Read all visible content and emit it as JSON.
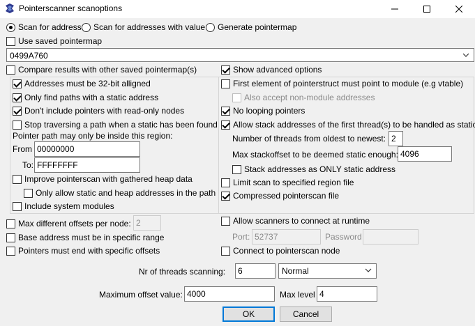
{
  "window": {
    "title": "Pointerscanner scanoptions"
  },
  "scan_mode": {
    "scan_for_address": "Scan for address",
    "scan_for_addresses_with_value": "Scan for addresses with value",
    "generate_pointermap": "Generate pointermap"
  },
  "use_saved_pointermap": "Use saved pointermap",
  "address_value": "0499A760",
  "compare_results": "Compare results with other saved pointermap(s)",
  "show_advanced": "Show advanced options",
  "left_group": {
    "aligned": "Addresses must be 32-bit alligned",
    "static_paths": "Only find paths with a static address",
    "no_readonly": "Don't include pointers with read-only nodes",
    "stop_traversing": "Stop traversing a path when a static has been found",
    "region_label": "Pointer path may only be inside this region:",
    "from_label": "From",
    "from_value": "00000000",
    "to_label": "To:",
    "to_value": "FFFFFFFF",
    "improve_heap": "Improve pointerscan with gathered heap data",
    "only_static_heap": "Only allow static and heap addresses in the path",
    "system_modules": "Include system modules"
  },
  "right_group": {
    "first_element": "First element of pointerstruct must point to module (e.g vtable)",
    "non_module": "Also accept non-module addresses",
    "no_looping": "No looping pointers",
    "allow_stack": "Allow stack addresses of the first thread(s) to be handled as static",
    "threads_label": "Number of threads from oldest to newest:",
    "threads_value": "2",
    "stackoffset_label": "Max stackoffset to be deemed static enough:",
    "stackoffset_value": "4096",
    "stack_only_static": "Stack addresses as ONLY static address",
    "limit_region": "Limit scan to specified region file",
    "compressed": "Compressed pointerscan file"
  },
  "bottom": {
    "max_offsets": "Max different offsets per node:",
    "max_offsets_value": "2",
    "base_range": "Base address must be in specific range",
    "end_offsets": "Pointers must end with specific offsets",
    "allow_scanners": "Allow scanners to connect at runtime",
    "port_label": "Port:",
    "port_value": "52737",
    "password_label": "Password",
    "password_value": "",
    "connect_node": "Connect to pointerscan node",
    "nr_threads_label": "Nr of threads scanning:",
    "nr_threads_value": "6",
    "priority_value": "Normal",
    "max_offset_label": "Maximum offset value:",
    "max_offset_value": "4000",
    "max_level_label": "Max level",
    "max_level_value": "4"
  },
  "buttons": {
    "ok": "OK",
    "cancel": "Cancel"
  },
  "colors": {
    "accent": "#0078d7",
    "cheat_engine_icon": "#2f3a8f"
  }
}
